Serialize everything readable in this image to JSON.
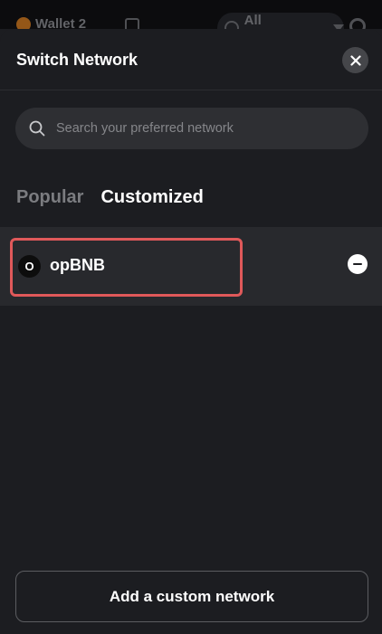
{
  "topbar": {
    "wallet_label": "Wallet 2",
    "networks_label": "All Networks"
  },
  "sheet": {
    "title": "Switch Network",
    "search_placeholder": "Search your preferred network",
    "tabs": [
      {
        "label": "Popular",
        "active": false
      },
      {
        "label": "Customized",
        "active": true
      }
    ],
    "networks": [
      {
        "name": "opBNB",
        "logo_letter": "O",
        "icon": "opbnb-logo-icon"
      }
    ],
    "add_button": "Add a custom network"
  },
  "colors": {
    "background": "#1c1d21",
    "row_background": "#28292d",
    "highlight_border": "#e0595a"
  }
}
